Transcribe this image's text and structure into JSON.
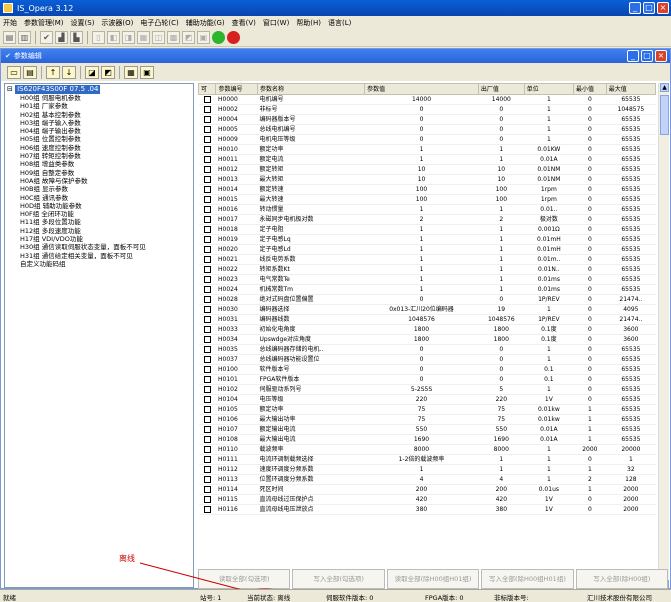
{
  "window": {
    "title": "IS_Opera 3.12"
  },
  "menu": [
    "开始",
    "参数管理(M)",
    "设置(S)",
    "示波器(O)",
    "电子凸轮(C)",
    "辅助功能(G)",
    "查看(V)",
    "窗口(W)",
    "帮助(H)",
    "语言(L)"
  ],
  "toolbar": {
    "icons": [
      "open-icon",
      "save-icon",
      "check-icon",
      "chart-icon",
      "disabled-icon",
      "disabled-icon",
      "disabled-icon",
      "disabled-icon",
      "disabled-icon",
      "disabled-icon",
      "connect-green-icon",
      "stop-red-icon"
    ]
  },
  "child_window": {
    "title": "参数编辑"
  },
  "toolbar2": {
    "icons": [
      "open-folder-icon",
      "save-icon",
      "up-icon",
      "down-icon",
      "import-icon",
      "export-icon",
      "compare-icon",
      "print-icon"
    ]
  },
  "tree": {
    "root": "IS620F43S00F 07.5 .04",
    "nodes": [
      "H00组 伺服电机参数",
      "H01组 厂家参数",
      "H02组 基本控制参数",
      "H03组 端子输入参数",
      "H04组 端子输出参数",
      "H05组 位置控制参数",
      "H06组 速度控制参数",
      "H07组 转矩控制参数",
      "H08组 增益类参数",
      "H09组 自整定参数",
      "H0A组 故障与保护参数",
      "H0B组 显示参数",
      "H0C组 通讯参数",
      "H0D组 辅助功能参数",
      "H0F组 全闭环功能",
      "H11组 多段位置功能",
      "H12组 多段速度功能",
      "H17组 VDI/VDO功能",
      "H30组 通信读取伺服状态变量，面板不可见",
      "H31组 通信给定相关变量，面板不可见",
      "自定义功能码组"
    ]
  },
  "table": {
    "headers": [
      "可",
      "参数编号",
      "参数名称",
      "参数值",
      "出厂值",
      "单位",
      "最小值",
      "最大值"
    ],
    "rows": [
      [
        "H0000",
        "电机编号",
        "14000",
        "14000",
        "1",
        "0",
        "65535"
      ],
      [
        "H0002",
        "非标号",
        "0",
        "0",
        "1",
        "0",
        "1048575"
      ],
      [
        "H0004",
        "编码器版本号",
        "0",
        "0",
        "1",
        "0",
        "65535"
      ],
      [
        "H0005",
        "总线电机编号",
        "0",
        "0",
        "1",
        "0",
        "65535"
      ],
      [
        "H0009",
        "电机电压等级",
        "0",
        "0",
        "1",
        "0",
        "65535"
      ],
      [
        "H0010",
        "额定功率",
        "1",
        "1",
        "0.01KW",
        "0",
        "65535"
      ],
      [
        "H0011",
        "额定电流",
        "1",
        "1",
        "0.01A",
        "0",
        "65535"
      ],
      [
        "H0012",
        "额定转矩",
        "10",
        "10",
        "0.01NM",
        "0",
        "65535"
      ],
      [
        "H0013",
        "最大转矩",
        "10",
        "10",
        "0.01NM",
        "0",
        "65535"
      ],
      [
        "H0014",
        "额定转速",
        "100",
        "100",
        "1rpm",
        "0",
        "65535"
      ],
      [
        "H0015",
        "最大转速",
        "100",
        "100",
        "1rpm",
        "0",
        "65535"
      ],
      [
        "H0016",
        "转动惯量",
        "1",
        "1",
        "0.01..",
        "0",
        "65535"
      ],
      [
        "H0017",
        "永磁同步电机极对数",
        "2",
        "2",
        "极对数",
        "0",
        "65535"
      ],
      [
        "H0018",
        "定子电阻",
        "1",
        "1",
        "0.001Ω",
        "0",
        "65535"
      ],
      [
        "H0019",
        "定子电感Lq",
        "1",
        "1",
        "0.01mH",
        "0",
        "65535"
      ],
      [
        "H0020",
        "定子电感Ld",
        "1",
        "1",
        "0.01mH",
        "0",
        "65535"
      ],
      [
        "H0021",
        "线反电势系数",
        "1",
        "1",
        "0.01m..",
        "0",
        "65535"
      ],
      [
        "H0022",
        "转矩系数Kt",
        "1",
        "1",
        "0.01N..",
        "0",
        "65535"
      ],
      [
        "H0023",
        "电气常数Te",
        "1",
        "1",
        "0.01ms",
        "0",
        "65535"
      ],
      [
        "H0024",
        "机械常数Tm",
        "1",
        "1",
        "0.01ms",
        "0",
        "65535"
      ],
      [
        "H0028",
        "绝对式码盘位置偏置",
        "0",
        "0",
        "1P/REV",
        "0",
        "21474.."
      ],
      [
        "H0030",
        "编码器选择",
        "0x013-汇川20位编码器",
        "19",
        "1",
        "0",
        "4095"
      ],
      [
        "H0031",
        "编码器线数",
        "1048576",
        "1048576",
        "1P/REV",
        "0",
        "21474.."
      ],
      [
        "H0033",
        "初始化电角度",
        "1800",
        "1800",
        "0.1度",
        "0",
        "3600"
      ],
      [
        "H0034",
        "Upswdge对应角度",
        "1800",
        "1800",
        "0.1度",
        "0",
        "3600"
      ],
      [
        "H0035",
        "总线编码器存储的电机..",
        "0",
        "0",
        "1",
        "0",
        "65535"
      ],
      [
        "H0037",
        "总线编码器功能设置位",
        "0",
        "0",
        "1",
        "0",
        "65535"
      ],
      [
        "H0100",
        "软件版本号",
        "0",
        "0",
        "0.1",
        "0",
        "65535"
      ],
      [
        "H0101",
        "FPGA软件版本",
        "0",
        "0",
        "0.1",
        "0",
        "65535"
      ],
      [
        "H0102",
        "伺服驱动系列号",
        "5-2S5S",
        "5",
        "1",
        "0",
        "65535"
      ],
      [
        "H0104",
        "电压等级",
        "220",
        "220",
        "1V",
        "0",
        "65535"
      ],
      [
        "H0105",
        "额定功率",
        "75",
        "75",
        "0.01kw",
        "1",
        "65535"
      ],
      [
        "H0106",
        "最大输出功率",
        "75",
        "75",
        "0.01kw",
        "1",
        "65535"
      ],
      [
        "H0107",
        "额定输出电流",
        "550",
        "550",
        "0.01A",
        "1",
        "65535"
      ],
      [
        "H0108",
        "最大输出电流",
        "1690",
        "1690",
        "0.01A",
        "1",
        "65535"
      ],
      [
        "H0110",
        "载波频率",
        "8000",
        "8000",
        "1",
        "2000",
        "20000"
      ],
      [
        "H0111",
        "电流环调制载频选择",
        "1-2倍的载波频率",
        "1",
        "1",
        "0",
        "1"
      ],
      [
        "H0112",
        "速度环调度分频系数",
        "1",
        "1",
        "1",
        "1",
        "32"
      ],
      [
        "H0113",
        "位置环调度分频系数",
        "4",
        "4",
        "1",
        "2",
        "128"
      ],
      [
        "H0114",
        "死区时间",
        "200",
        "200",
        "0.01us",
        "1",
        "2000"
      ],
      [
        "H0115",
        "直流母线过压保护点",
        "420",
        "420",
        "1V",
        "0",
        "2000"
      ],
      [
        "H0116",
        "直流母线电压泄放点",
        "380",
        "380",
        "1V",
        "0",
        "2000"
      ]
    ]
  },
  "buttons": [
    "读取全部(勾选项)",
    "写入全部(勾选项)",
    "读取全部(除H00组H01组)",
    "写入全部(除H00组H01组)",
    "写入全部(除H00组)"
  ],
  "annotation": {
    "label": "离线"
  },
  "status": {
    "ready": "就绪",
    "station": "站号: 1",
    "state": "当前状态: 离线",
    "servo_sw": "伺服软件版本: 0",
    "fpga": "FPGA版本: 0",
    "nonstd": "非标版本号:",
    "company": "汇川技术股份有限公司"
  }
}
